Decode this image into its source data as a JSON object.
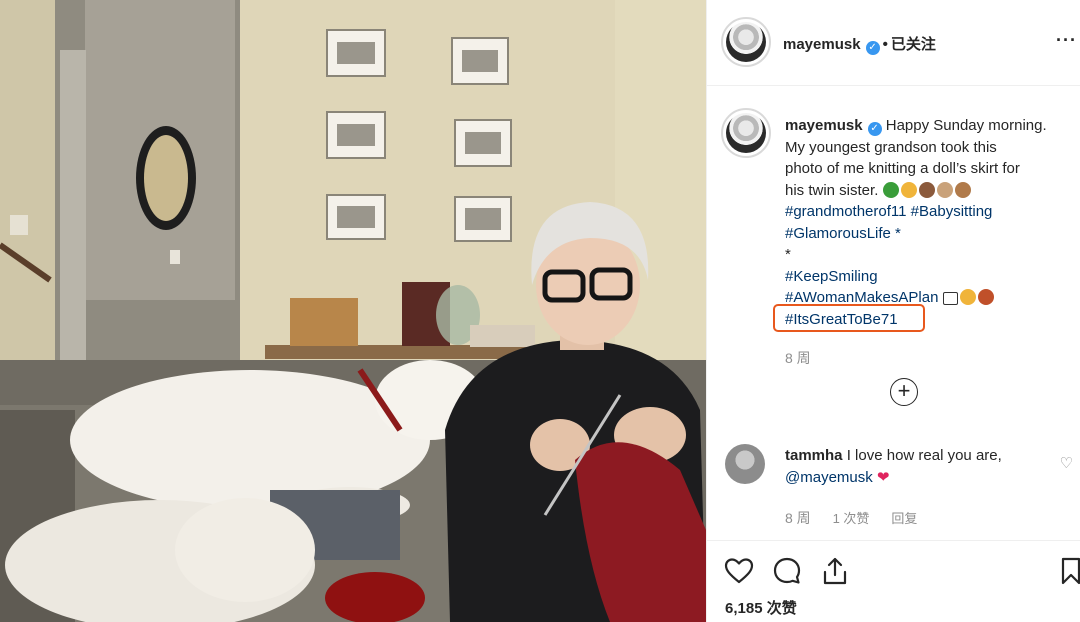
{
  "post_header": {
    "username": "mayemusk",
    "verified": true,
    "separator": "•",
    "follow_state": "已关注",
    "more_icon": "more-dots-icon"
  },
  "caption": {
    "username": "mayemusk",
    "lines": [
      "Happy Sunday morning.",
      "My youngest grandson took this",
      "photo of me knitting a doll’s skirt for",
      "his twin sister."
    ],
    "hashtags_1": [
      "#grandmotherof11",
      "#Babysitting"
    ],
    "hashtag_line2": "#GlamorousLife *",
    "asterisk": "*",
    "hashtag_keep": "#KeepSmiling",
    "hashtag_plan": "#AWomanMakesAPlan",
    "hashtag_highlighted": "#ItsGreatToBe71",
    "time": "8 周",
    "emoji_colors": [
      "#3a9d3a",
      "#f0b43a",
      "#8b5a3c",
      "#c9a27a",
      "#b07a4a"
    ]
  },
  "load_more_icon": "plus-circle-icon",
  "comment": {
    "username": "tammha",
    "text": "I love how real you are,",
    "mention": "@mayemusk",
    "heart_emoji_color": "#e0245e",
    "time": "8 周",
    "likes": "1 次赞",
    "reply": "回复"
  },
  "actions": {
    "like_icon": "heart-icon",
    "comment_icon": "comment-icon",
    "share_icon": "share-icon",
    "save_icon": "bookmark-icon",
    "likes_count": "6,185 次赞"
  },
  "colors": {
    "hashtag": "#003569",
    "highlight_border": "#e8581d",
    "verified": "#3897f0",
    "muted": "#8e8e8e"
  }
}
